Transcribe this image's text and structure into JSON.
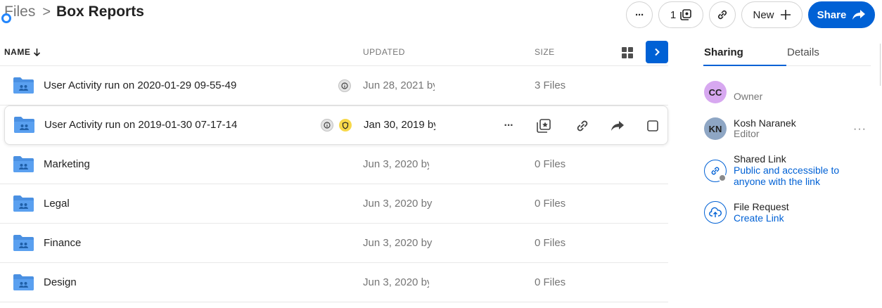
{
  "breadcrumb": {
    "root": "Files",
    "separator": ">",
    "current": "Box Reports"
  },
  "toolbar": {
    "more_label": "···",
    "collab_count": "1",
    "new_label": "New",
    "share_label": "Share"
  },
  "list_header": {
    "name": "NAME",
    "updated": "UPDATED",
    "size": "SIZE"
  },
  "rows": [
    {
      "name": "User Activity run on 2020-01-29 09-55-49",
      "updated": "Jun 28, 2021 by",
      "size": "3 Files",
      "badges": [
        "info"
      ]
    },
    {
      "name": "User Activity run on 2019-01-30 07-17-14",
      "updated": "Jan 30, 2019 by",
      "size": "",
      "badges": [
        "info",
        "shield"
      ]
    },
    {
      "name": "Marketing",
      "updated": "Jun 3, 2020 by",
      "size": "0 Files",
      "badges": []
    },
    {
      "name": "Legal",
      "updated": "Jun 3, 2020 by",
      "size": "0 Files",
      "badges": []
    },
    {
      "name": "Finance",
      "updated": "Jun 3, 2020 by",
      "size": "0 Files",
      "badges": []
    },
    {
      "name": "Design",
      "updated": "Jun 3, 2020 by",
      "size": "0 Files",
      "badges": []
    }
  ],
  "row_actions": {
    "more_label": "···"
  },
  "sidebar": {
    "tabs": {
      "active": "Sharing",
      "inactive": "Details"
    },
    "owner": {
      "initials": "CC",
      "role": "Owner",
      "color": "#d7a8f0"
    },
    "editor": {
      "initials": "KN",
      "name": "Kosh Naranek",
      "role": "Editor",
      "color": "#8ea6c4",
      "more_label": "···"
    },
    "shared_link": {
      "title": "Shared Link",
      "description": "Public and accessible to anyone with the link"
    },
    "file_request": {
      "title": "File Request",
      "action": "Create Link"
    }
  },
  "colors": {
    "accent": "#0061d5",
    "folder": "#4a90e2"
  },
  "icons": [
    "chevron-right-icon",
    "duplicate-icon",
    "link-icon",
    "plus-icon",
    "share-arrow-icon",
    "sort-arrow-down-icon",
    "grid-view-icon",
    "folder-collab-icon",
    "info-icon",
    "shield-icon",
    "collection-star-icon",
    "checkbox-icon",
    "globe-icon",
    "upload-cloud-icon"
  ]
}
